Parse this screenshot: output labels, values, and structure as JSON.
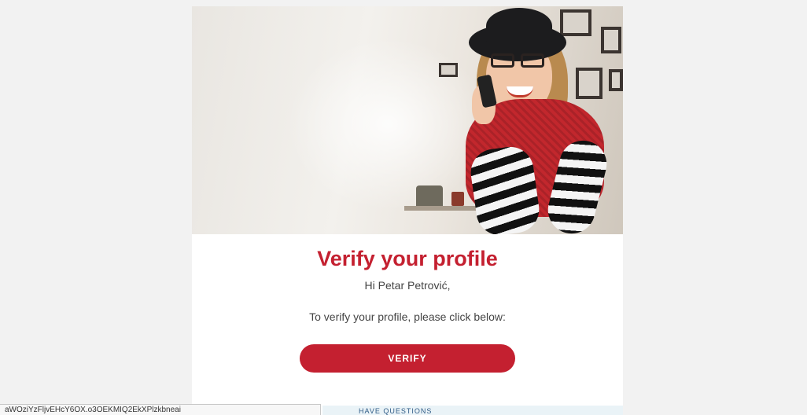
{
  "email": {
    "hero_alt": "Smiling woman talking on a phone",
    "title": "Verify your profile",
    "greeting": "Hi Petar Petrović,",
    "instruction": "To verify your profile, please click below:",
    "verify_button_label": "VERIFY"
  },
  "status_bar": {
    "url_fragment": "aWOziYzFljvEHcY6OX.o3OEKMIQ2EkXPlzkbneai"
  },
  "next_section": {
    "heading_fragment": "HAVE QUESTIONS"
  },
  "colors": {
    "accent": "#c42030",
    "background": "#f2f2f2",
    "card": "#ffffff"
  }
}
